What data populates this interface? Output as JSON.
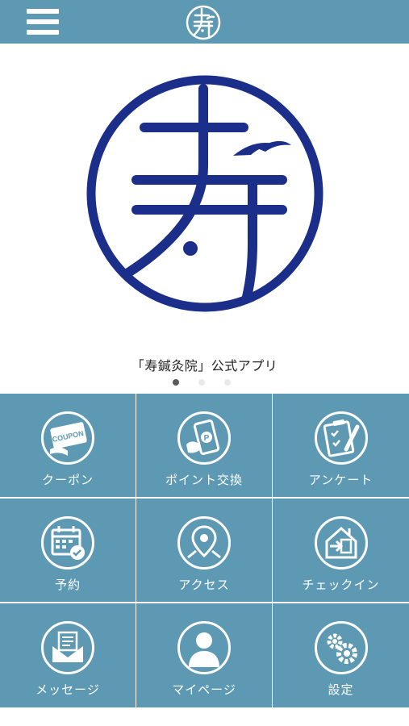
{
  "header": {
    "menu_icon": "hamburger-menu-icon",
    "logo_icon": "kotobuki-logo-icon"
  },
  "hero": {
    "logo_icon": "kotobuki-logo-icon",
    "caption": "「寿鍼灸院」公式アプリ"
  },
  "carousel": {
    "total": 3,
    "active": 1
  },
  "menu": {
    "items": [
      {
        "label": "クーポン",
        "icon": "coupon-icon"
      },
      {
        "label": "ポイント交換",
        "icon": "point-exchange-icon"
      },
      {
        "label": "アンケート",
        "icon": "survey-clipboard-icon"
      },
      {
        "label": "予約",
        "icon": "calendar-reservation-icon"
      },
      {
        "label": "アクセス",
        "icon": "map-pin-icon"
      },
      {
        "label": "チェックイン",
        "icon": "checkin-house-icon"
      },
      {
        "label": "メッセージ",
        "icon": "message-inbox-icon"
      },
      {
        "label": "マイページ",
        "icon": "user-profile-icon"
      },
      {
        "label": "設定",
        "icon": "settings-gears-icon"
      }
    ]
  },
  "colors": {
    "brand_blue": "#5e99b3",
    "logo_navy": "#1b2f8a",
    "text_dark": "#222222"
  }
}
